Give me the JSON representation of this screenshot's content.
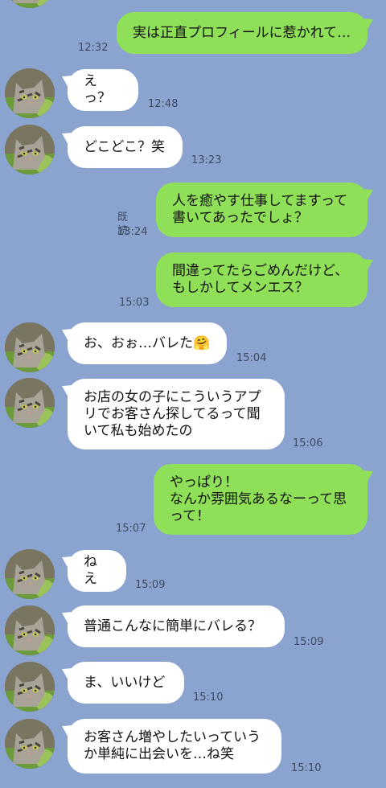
{
  "messages": [
    {
      "dir": "out",
      "text": "実は正直プロフィールに惹かれて…",
      "time": "12:32",
      "read": ""
    },
    {
      "dir": "in",
      "text": "えっ？",
      "time": "12:48"
    },
    {
      "dir": "in",
      "text": "どこどこ？笑",
      "time": "13:23"
    },
    {
      "dir": "out",
      "text": "人を癒やす仕事してますって\n書いてあったでしょ？",
      "time": "13:24",
      "read": "既読"
    },
    {
      "dir": "out",
      "text": "間違ってたらごめんだけど、\nもしかしてメンエス？",
      "time": "15:03",
      "read": ""
    },
    {
      "dir": "in",
      "text": "お、おぉ…バレた🤗",
      "time": "15:04"
    },
    {
      "dir": "in",
      "text": "お店の女の子にこういうアプ\nリでお客さん探してるって聞\nいて私も始めたの",
      "time": "15:06"
    },
    {
      "dir": "out",
      "text": "やっぱり！\nなんか雰囲気あるなーって思\nって！",
      "time": "15:07",
      "read": ""
    },
    {
      "dir": "in",
      "text": "ねえ",
      "time": "15:09"
    },
    {
      "dir": "in",
      "text": "普通こんなに簡単にバレる？",
      "time": "15:09"
    },
    {
      "dir": "in",
      "text": "ま、いいけど",
      "time": "15:10"
    },
    {
      "dir": "in",
      "text": "お客さん増やしたいっていう\nか単純に出会いを…ね笑",
      "time": "15:10"
    }
  ],
  "colors": {
    "background": "#8ba4cf",
    "outgoing": "#8fe058",
    "incoming": "#ffffff"
  },
  "avatar_icon": "cat-photo-icon"
}
